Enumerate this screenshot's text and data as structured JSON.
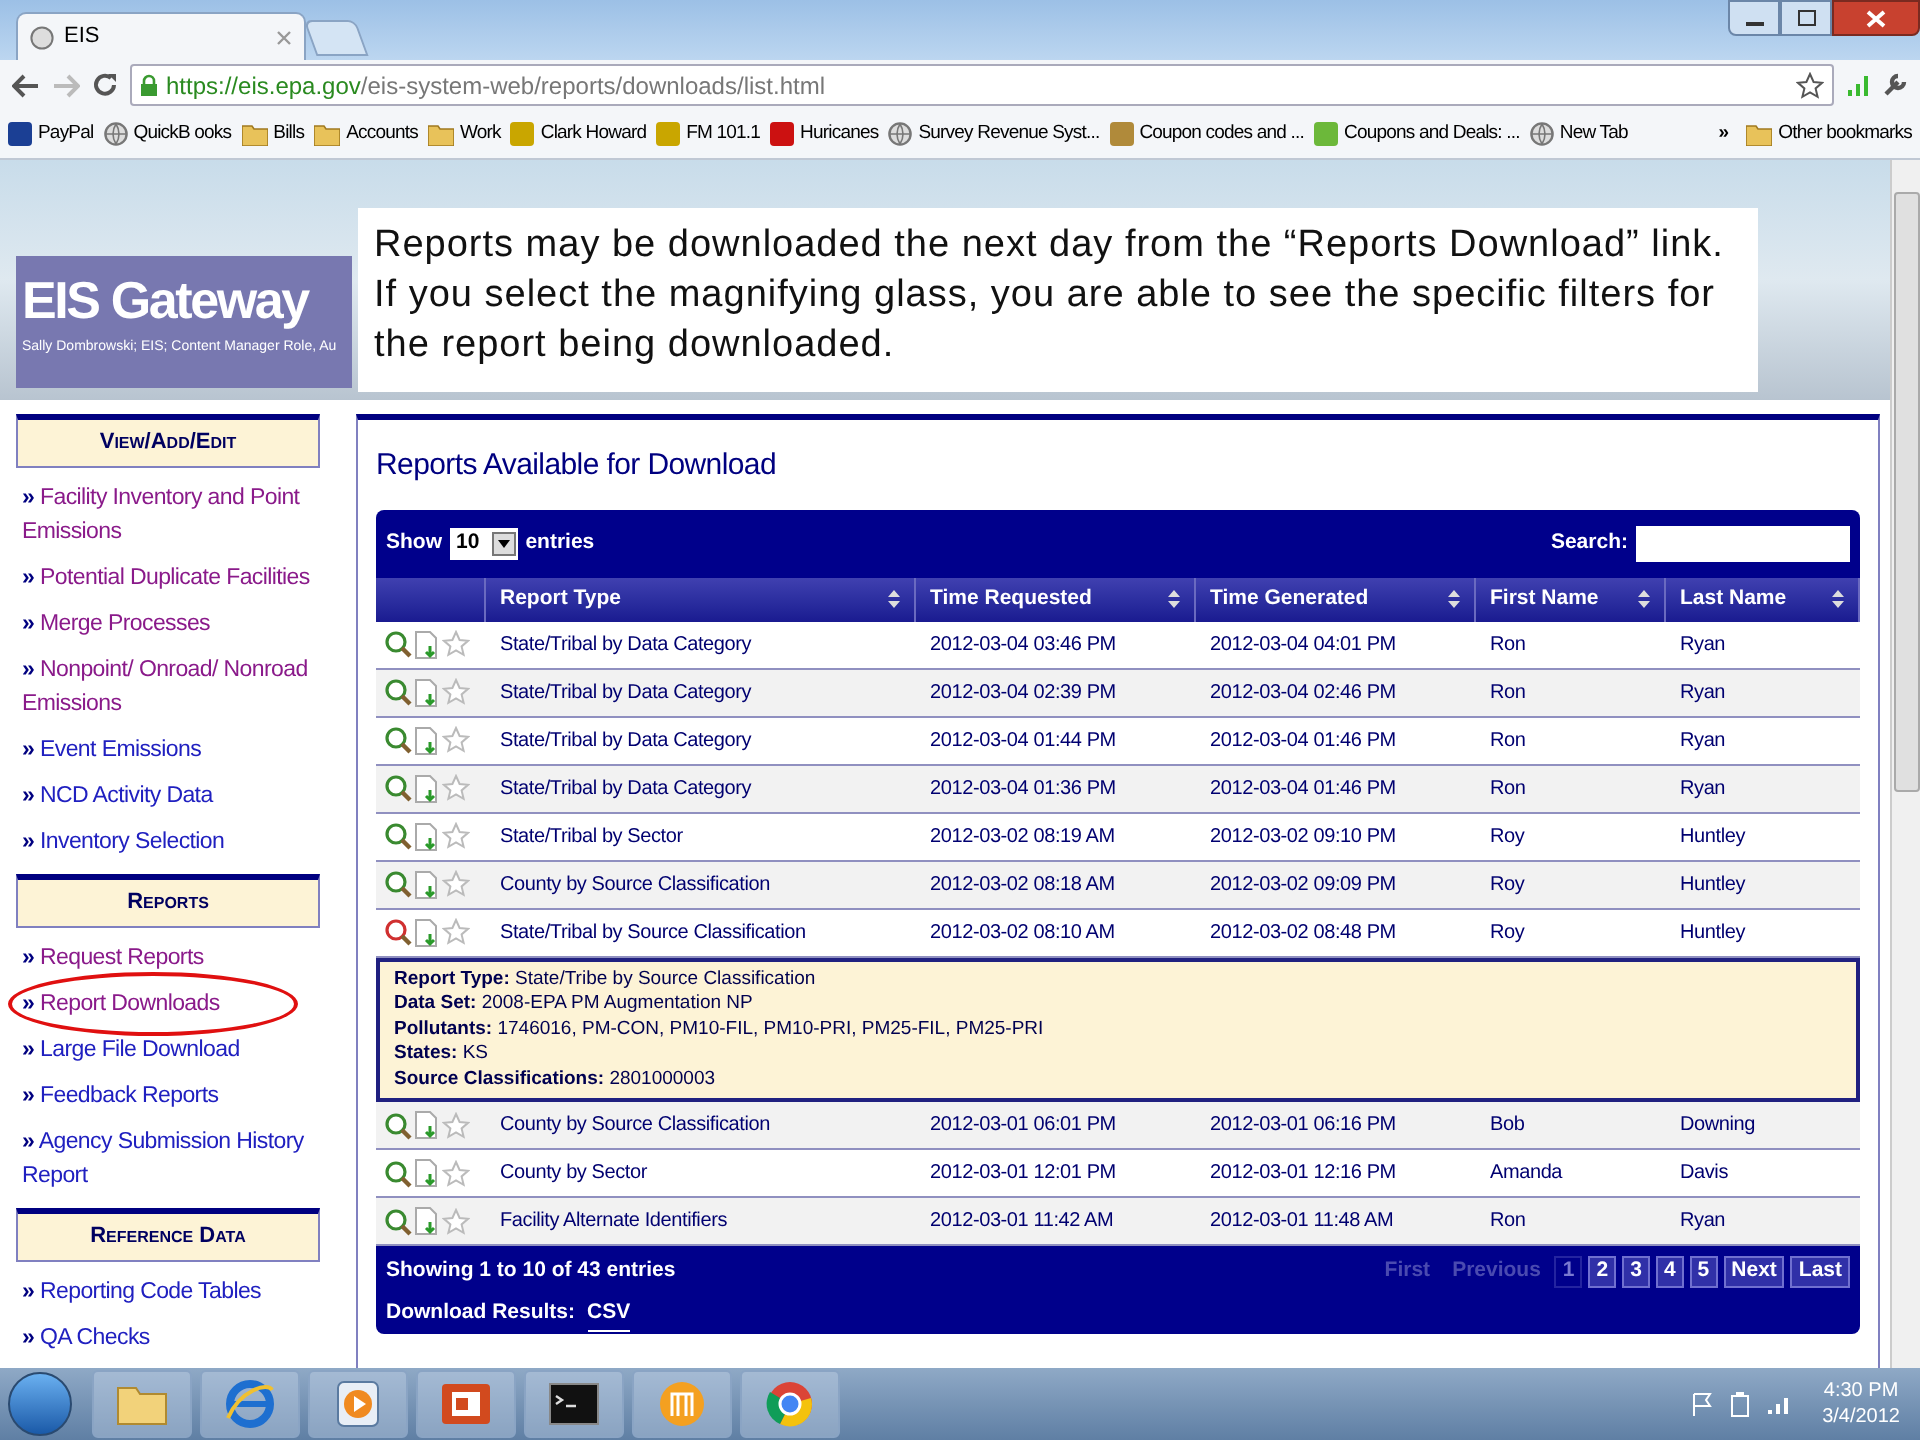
{
  "browser": {
    "tab_title": "EIS",
    "url_host": "https://eis.epa.gov",
    "url_path": "/eis-system-web/reports/downloads/list.html",
    "bookmarks": [
      {
        "label": "PayPal",
        "kind": "logo",
        "color": "#1b3f94"
      },
      {
        "label": "QuickB ooks",
        "kind": "globe",
        "color": "#777777"
      },
      {
        "label": "Bills",
        "kind": "folder",
        "color": "#e8c25a"
      },
      {
        "label": "Accounts",
        "kind": "folder",
        "color": "#e8c25a"
      },
      {
        "label": "Work",
        "kind": "folder",
        "color": "#e8c25a"
      },
      {
        "label": "Clark Howard",
        "kind": "logo",
        "color": "#c9a600"
      },
      {
        "label": "FM 101.1",
        "kind": "logo",
        "color": "#c9a600"
      },
      {
        "label": "Huricanes",
        "kind": "logo",
        "color": "#cc1111"
      },
      {
        "label": "Survey Revenue Syst...",
        "kind": "globe",
        "color": "#777777"
      },
      {
        "label": "Coupon codes and ...",
        "kind": "logo",
        "color": "#b08a3a"
      },
      {
        "label": "Coupons and Deals: ...",
        "kind": "logo",
        "color": "#6cb83a"
      },
      {
        "label": "New Tab",
        "kind": "globe",
        "color": "#777777"
      }
    ],
    "overflow": "»",
    "other_bookmarks": "Other bookmarks"
  },
  "header": {
    "title": "EIS Gateway",
    "user": "Sally Dombrowski; EIS; Content Manager Role, Au"
  },
  "callout": "Reports may be downloaded the next day from the “Reports Download” link.  If you select the magnifying glass, you are able to see the specific filters for the report being downloaded.",
  "sidebar": [
    {
      "heading": "View/Add/Edit",
      "items": [
        {
          "marker": "»",
          "label": "Facility Inventory and Point Emissions",
          "visited": true,
          "circled": false
        },
        {
          "marker": "»",
          "label": "Potential Duplicate Facilities",
          "visited": true,
          "circled": false
        },
        {
          "marker": "»",
          "label": "Merge Processes",
          "visited": true,
          "circled": false
        },
        {
          "marker": "»",
          "label": "Nonpoint/ Onroad/ Nonroad Emissions",
          "visited": true,
          "circled": false
        },
        {
          "marker": "»",
          "label": "Event Emissions",
          "visited": false,
          "circled": false
        },
        {
          "marker": "»",
          "label": "NCD Activity Data",
          "visited": false,
          "circled": false
        },
        {
          "marker": "»",
          "label": "Inventory Selection",
          "visited": false,
          "circled": false
        }
      ]
    },
    {
      "heading": "Reports",
      "items": [
        {
          "marker": "»",
          "label": "Request Reports",
          "visited": true,
          "circled": false
        },
        {
          "marker": "»",
          "label": "Report Downloads",
          "visited": true,
          "circled": true
        },
        {
          "marker": "»",
          "label": "Large File Download",
          "visited": false,
          "circled": false
        },
        {
          "marker": "»",
          "label": "Feedback Reports",
          "visited": false,
          "circled": false
        },
        {
          "marker": "»",
          "label": "Agency Submission History Report",
          "visited": false,
          "circled": false
        }
      ]
    },
    {
      "heading": "Reference Data",
      "items": [
        {
          "marker": "»",
          "label": "Reporting Code Tables",
          "visited": false,
          "circled": false
        },
        {
          "marker": "»",
          "label": "QA Checks",
          "visited": false,
          "circled": false
        }
      ]
    }
  ],
  "main": {
    "title": "Reports Available for Download",
    "show_label": "Show",
    "page_size": "10",
    "entries_label": "entries",
    "search_label": "Search:",
    "columns": [
      "Report Type",
      "Time Requested",
      "Time Generated",
      "First Name",
      "Last Name"
    ],
    "rows": [
      {
        "cells": [
          "State/Tribal by Data Category",
          "2012-03-04 03:46 PM",
          "2012-03-04 04:01 PM",
          "Ron",
          "Ryan"
        ],
        "expanded": false
      },
      {
        "cells": [
          "State/Tribal by Data Category",
          "2012-03-04 02:39 PM",
          "2012-03-04 02:46 PM",
          "Ron",
          "Ryan"
        ],
        "expanded": false
      },
      {
        "cells": [
          "State/Tribal by Data Category",
          "2012-03-04 01:44 PM",
          "2012-03-04 01:46 PM",
          "Ron",
          "Ryan"
        ],
        "expanded": false
      },
      {
        "cells": [
          "State/Tribal by Data Category",
          "2012-03-04 01:36 PM",
          "2012-03-04 01:46 PM",
          "Ron",
          "Ryan"
        ],
        "expanded": false
      },
      {
        "cells": [
          "State/Tribal by Sector",
          "2012-03-02 08:19 AM",
          "2012-03-02 09:10 PM",
          "Roy",
          "Huntley"
        ],
        "expanded": false
      },
      {
        "cells": [
          "County by Source Classification",
          "2012-03-02 08:18 AM",
          "2012-03-02 09:09 PM",
          "Roy",
          "Huntley"
        ],
        "expanded": false
      },
      {
        "cells": [
          "State/Tribal by Source Classification",
          "2012-03-02 08:10 AM",
          "2012-03-02 08:48 PM",
          "Roy",
          "Huntley"
        ],
        "expanded": true,
        "details": [
          "**Report Type:** State/Tribe by Source Classification",
          "**Data Set:** 2008-EPA PM Augmentation NP",
          "**Pollutants:** 1746016, PM-CON, PM10-FIL, PM10-PRI, PM25-FIL, PM25-PRI",
          "**States:** KS",
          "**Source Classifications:** 2801000003"
        ]
      },
      {
        "cells": [
          "County by Source Classification",
          "2012-03-01 06:01 PM",
          "2012-03-01 06:16 PM",
          "Bob",
          "Downing"
        ],
        "expanded": false
      },
      {
        "cells": [
          "County by Sector",
          "2012-03-01 12:01 PM",
          "2012-03-01 12:16 PM",
          "Amanda",
          "Davis"
        ],
        "expanded": false
      },
      {
        "cells": [
          "Facility Alternate Identifiers",
          "2012-03-01 11:42 AM",
          "2012-03-01 11:48 AM",
          "Ron",
          "Ryan"
        ],
        "expanded": false
      }
    ],
    "info": "Showing 1 to 10 of 43 entries",
    "download_label": "Download Results:",
    "download_link": "CSV",
    "pages": [
      {
        "label": "First",
        "disabled": true,
        "selected": false
      },
      {
        "label": "Previous",
        "disabled": true,
        "selected": false
      },
      {
        "label": "1",
        "disabled": false,
        "selected": true
      },
      {
        "label": "2",
        "disabled": false,
        "selected": false
      },
      {
        "label": "3",
        "disabled": false,
        "selected": false
      },
      {
        "label": "4",
        "disabled": false,
        "selected": false
      },
      {
        "label": "5",
        "disabled": false,
        "selected": false
      },
      {
        "label": "Next",
        "disabled": false,
        "selected": false
      },
      {
        "label": "Last",
        "disabled": false,
        "selected": false
      }
    ]
  },
  "taskbar": {
    "apps": [
      {
        "kind": "folder"
      },
      {
        "kind": "browser-e"
      },
      {
        "kind": "player"
      },
      {
        "kind": "slides"
      },
      {
        "kind": "terminal"
      },
      {
        "kind": "orange"
      },
      {
        "kind": "chrome"
      }
    ],
    "time": "4:30 PM",
    "date": "3/4/2012"
  }
}
